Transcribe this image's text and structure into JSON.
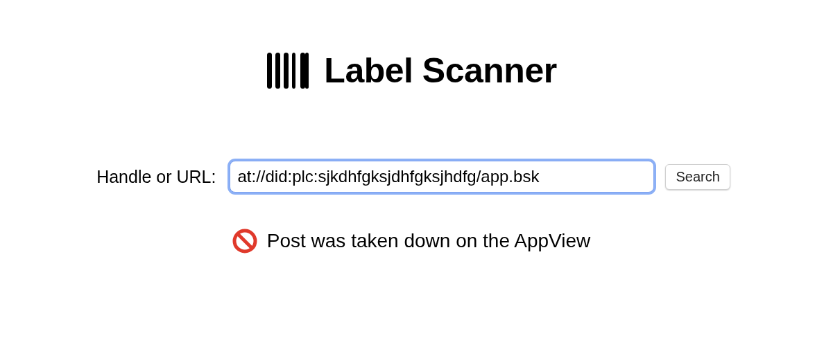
{
  "header": {
    "title": "Label Scanner"
  },
  "search_form": {
    "label": "Handle or URL:",
    "value": "at://did:plc:sjkdhfgksjdhfgksjhdfg/app.bsk",
    "focused": true,
    "button": "Search"
  },
  "result": {
    "kind": "prohibited",
    "message": "Post was taken down on the AppView"
  }
}
